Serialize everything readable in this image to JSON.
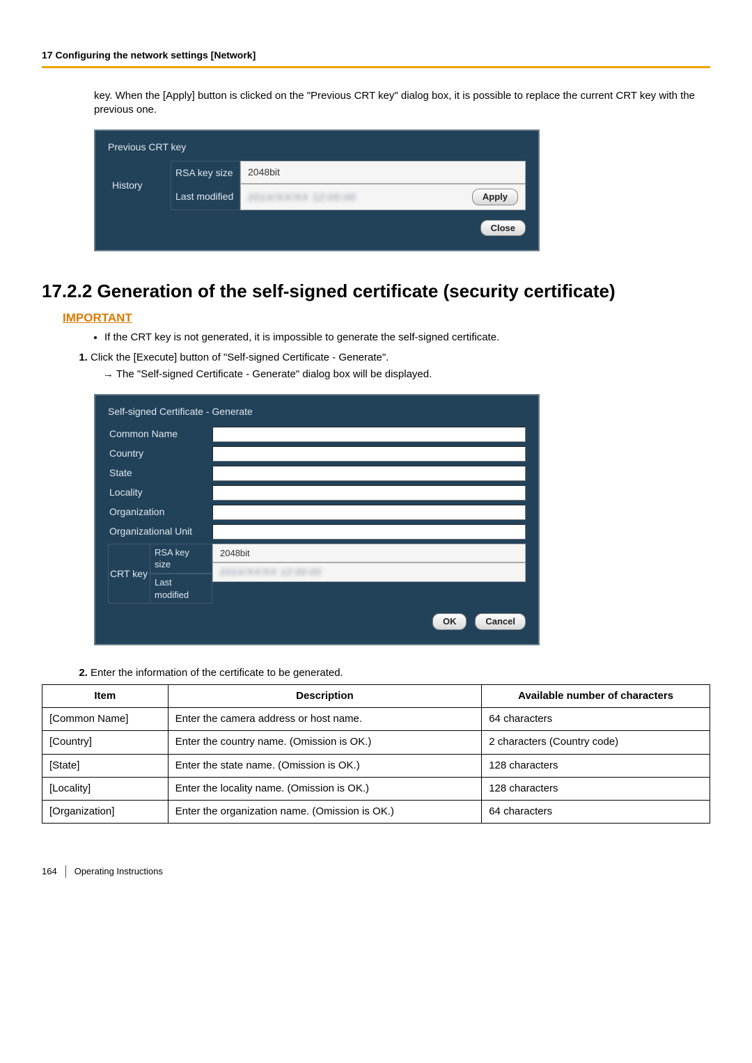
{
  "chapter_header": "17 Configuring the network settings [Network]",
  "intro_text": "key. When the [Apply] button is clicked on the \"Previous CRT key\" dialog box, it is possible to replace the current CRT key with the previous one.",
  "dialog1": {
    "title": "Previous CRT key",
    "history_label": "History",
    "rsa_label": "RSA key size",
    "rsa_value": "2048bit",
    "lastmod_label": "Last modified",
    "lastmod_value": "201X/XX/XX 12:00:00",
    "apply": "Apply",
    "close": "Close"
  },
  "section_heading": "17.2.2  Generation of the self-signed certificate (security certificate)",
  "important_label": "IMPORTANT",
  "important_text": "If the CRT key is not generated, it is impossible to generate the self-signed certificate.",
  "step1_text": "Click the [Execute] button of \"Self-signed Certificate - Generate\".",
  "step1_arrow": "→  The \"Self-signed Certificate - Generate\" dialog box will be displayed.",
  "dialog2": {
    "title": "Self-signed Certificate - Generate",
    "fields": {
      "common_name": "Common Name",
      "country": "Country",
      "state": "State",
      "locality": "Locality",
      "organization": "Organization",
      "org_unit": "Organizational Unit"
    },
    "crt_label": "CRT key",
    "rsa_label": "RSA key size",
    "rsa_value": "2048bit",
    "lastmod_label": "Last modified",
    "lastmod_value": "201X/XX/XX 12:00:00",
    "ok": "OK",
    "cancel": "Cancel"
  },
  "step2_text": "Enter the information of the certificate to be generated.",
  "table": {
    "headers": {
      "item": "Item",
      "desc": "Description",
      "chars": "Available number of characters"
    },
    "rows": [
      {
        "item": "[Common Name]",
        "desc": "Enter the camera address or host name.",
        "chars": "64 characters"
      },
      {
        "item": "[Country]",
        "desc": "Enter the country name. (Omission is OK.)",
        "chars": "2 characters (Country code)"
      },
      {
        "item": "[State]",
        "desc": "Enter the state name. (Omission is OK.)",
        "chars": "128 characters"
      },
      {
        "item": "[Locality]",
        "desc": "Enter the locality name. (Omission is OK.)",
        "chars": "128 characters"
      },
      {
        "item": "[Organization]",
        "desc": "Enter the organization name. (Omission is OK.)",
        "chars": "64 characters"
      }
    ]
  },
  "footer": {
    "page": "164",
    "doc": "Operating Instructions"
  }
}
